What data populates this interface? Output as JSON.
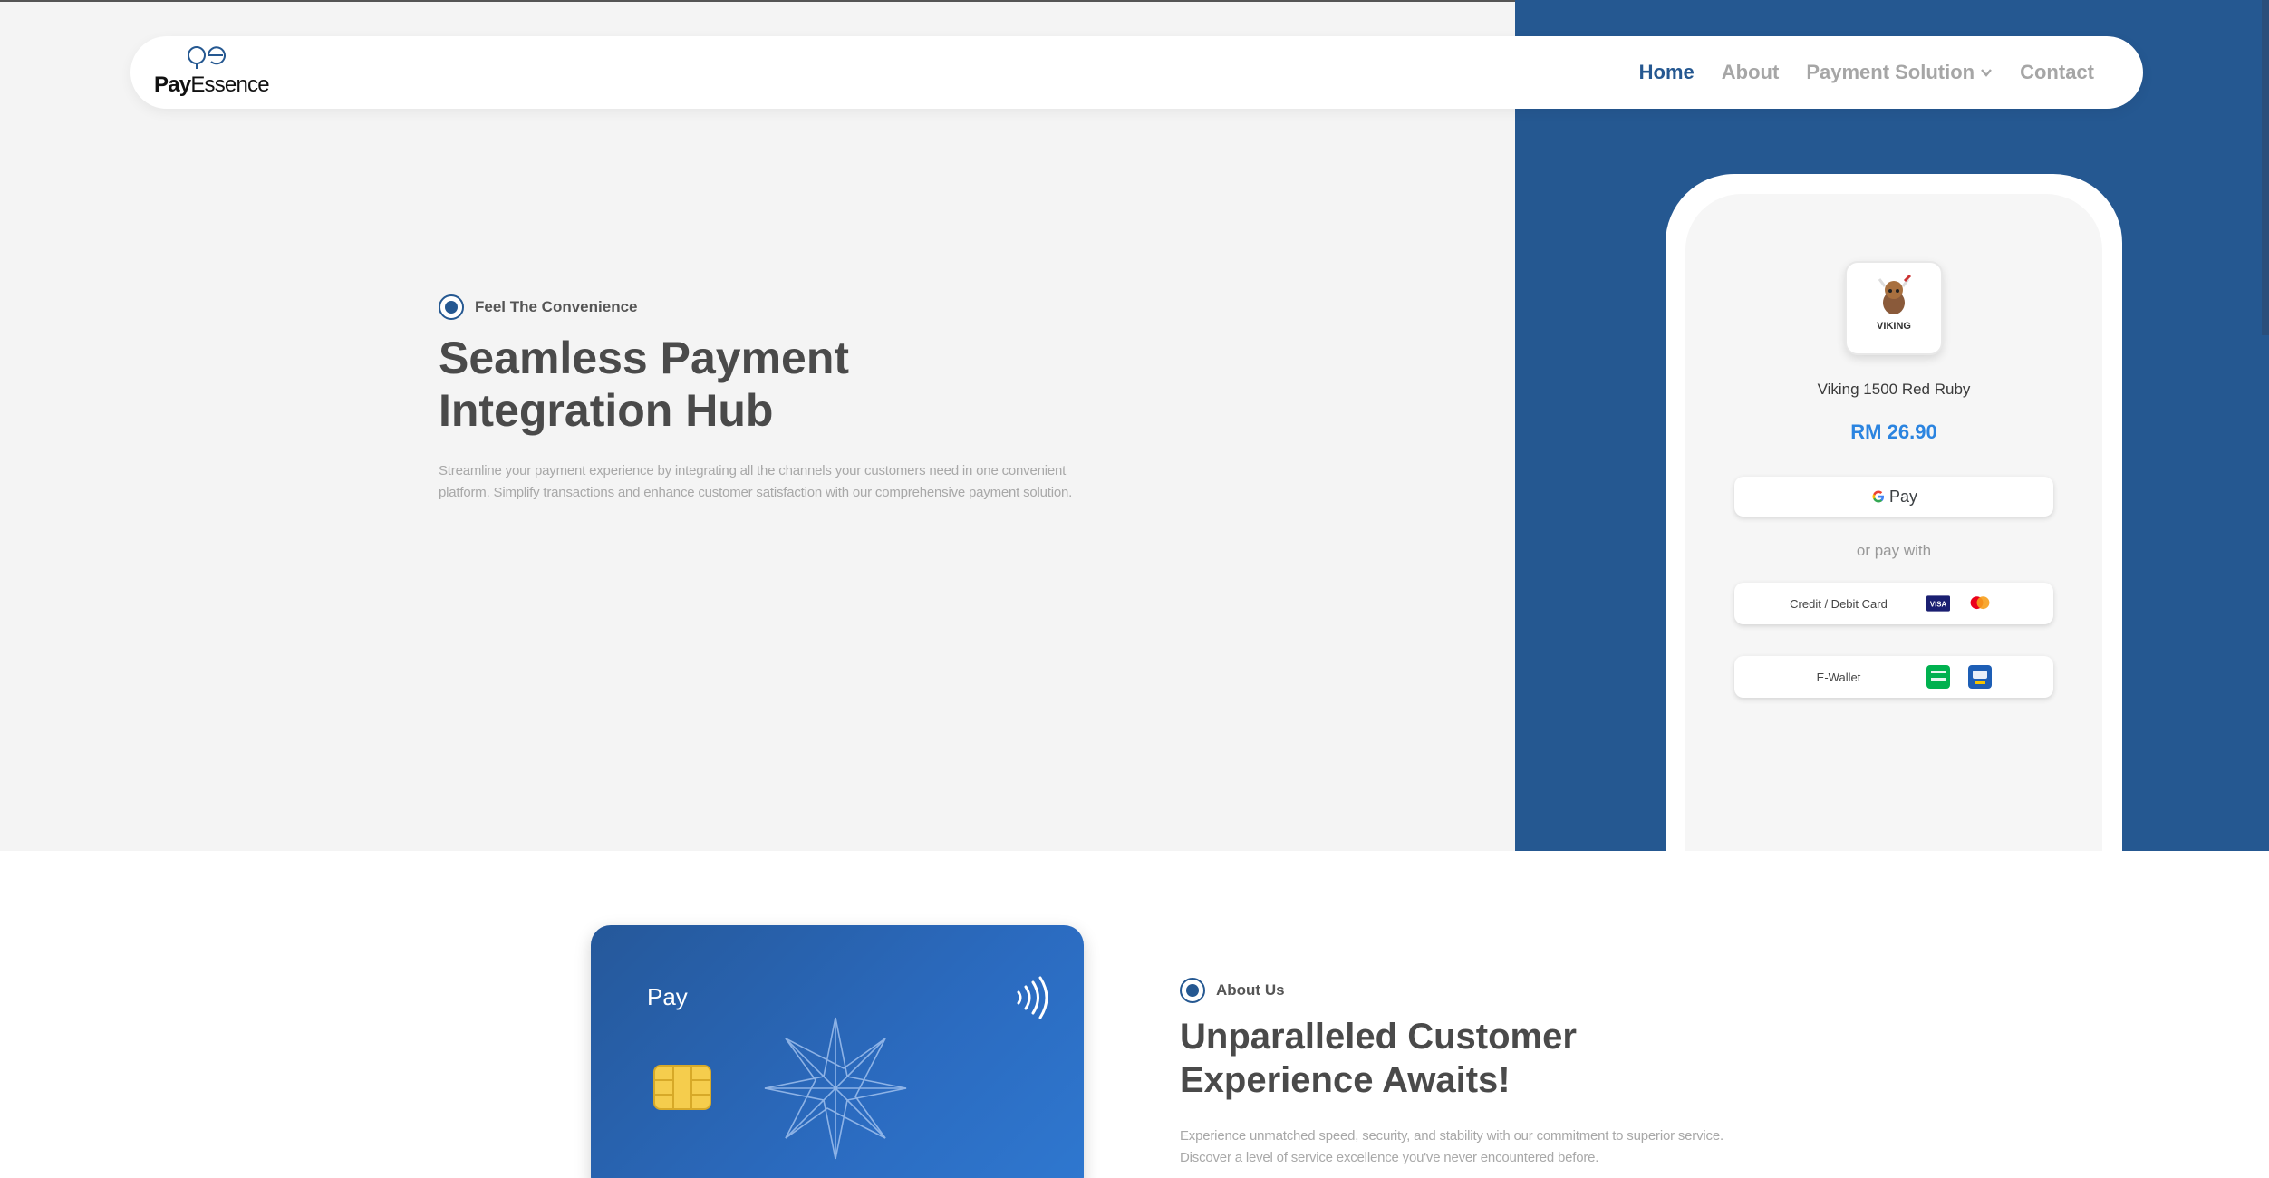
{
  "brand": {
    "logo_bold": "Pay",
    "logo_rest": "Essence",
    "primary_color": "#255891",
    "accent_price_color": "#2b84e0"
  },
  "nav": {
    "home": "Home",
    "about": "About",
    "payment_solution": "Payment Solution",
    "contact": "Contact"
  },
  "hero": {
    "eyebrow": "Feel The Convenience",
    "title_line1": "Seamless Payment",
    "title_line2": "Integration Hub",
    "description": "Streamline your payment experience by integrating all the channels your customers need in one convenient platform. Simplify transactions and enhance customer satisfaction with our comprehensive payment solution."
  },
  "checkout": {
    "product_logo_text": "VIKING",
    "product_name": "Viking 1500 Red Ruby",
    "price": "RM 26.90",
    "gpay_label": "Pay",
    "or_pay_with": "or pay with",
    "card_option": "Credit / Debit Card",
    "wallet_option": "E-Wallet",
    "icons": [
      "visa-icon",
      "mastercard-icon",
      "grabpay-icon",
      "touchngo-icon"
    ]
  },
  "card": {
    "label": "Pay"
  },
  "about": {
    "eyebrow": "About Us",
    "title_line1": "Unparalleled Customer",
    "title_line2": "Experience Awaits!",
    "description": "Experience unmatched speed, security, and stability with our commitment to superior service. Discover a level of service excellence you've never encountered before."
  }
}
